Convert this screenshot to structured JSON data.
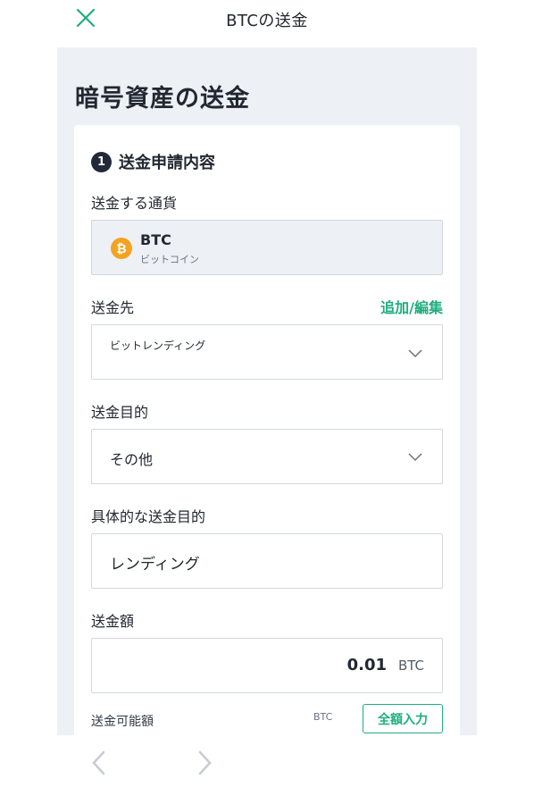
{
  "header": {
    "title": "BTCの送金",
    "close_icon": "close-icon"
  },
  "page": {
    "title": "暗号資産の送金"
  },
  "section": {
    "step": "1",
    "title": "送金申請内容"
  },
  "currency": {
    "label": "送金する通貨",
    "symbol": "BTC",
    "name": "ビットコイン",
    "icon_glyph": "₿",
    "icon": "bitcoin-icon"
  },
  "destination": {
    "label": "送金先",
    "edit_link": "追加/編集",
    "value": "ビットレンディング"
  },
  "purpose": {
    "label": "送金目的",
    "value": "その他"
  },
  "purpose_detail": {
    "label": "具体的な送金目的",
    "value": "レンディング"
  },
  "amount": {
    "label": "送金額",
    "value": "0.01",
    "unit": "BTC"
  },
  "available": {
    "label": "送金可能額",
    "unit": "BTC",
    "fill_button": "全額入力"
  },
  "colors": {
    "accent": "#1fae7d",
    "text": "#222831",
    "background": "#edf0f5",
    "bitcoin": "#f3a322"
  }
}
